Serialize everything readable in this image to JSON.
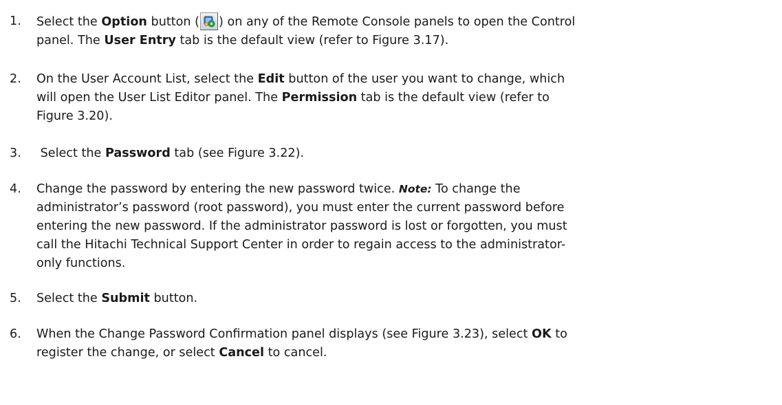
{
  "steps": [
    {
      "num": "1.",
      "line1_a": "Select the ",
      "line1_b": "Option",
      "line1_c": " button (",
      "icon": "option-gear-icon",
      "line1_d": ") on any of the Remote Console panels to open the Control",
      "line2_a": "panel. The ",
      "line2_b": "User Entry",
      "line2_c": " tab is the default view (refer to Figure 3.17)."
    },
    {
      "num": "2.",
      "line1_a": "On the User Account List, select the ",
      "line1_b": "Edit",
      "line1_c": " button of the user you want to change, which",
      "line2_a": "will open the User List Editor panel. The ",
      "line2_b": "Permission",
      "line2_c": " tab is the default view (refer to",
      "line3": "Figure 3.20)."
    },
    {
      "num": "3.",
      "line1_a": " Select the ",
      "line1_b": "Password",
      "line1_c": " tab (see Figure 3.22)."
    },
    {
      "num": "4.",
      "line1_a": "Change the password by entering the new password twice. ",
      "note": "Note:",
      "line1_c": " To change the",
      "line2": "administrator’s password (root password), you must enter the current password before",
      "line3": "entering the new password. If the administrator password is lost or forgotten, you must",
      "line4": "call the Hitachi Technical Support Center in order to regain access to the administrator-",
      "line5": "only functions."
    },
    {
      "num": "5.",
      "line1_a": "Select the ",
      "line1_b": "Submit",
      "line1_c": " button."
    },
    {
      "num": "6.",
      "line1_a": "When the Change Password Confirmation panel displays (see Figure 3.23), select ",
      "line1_b": "OK",
      "line1_c": " to",
      "line2_a": "register the change, or select ",
      "line2_b": "Cancel",
      "line2_c": " to cancel."
    }
  ]
}
